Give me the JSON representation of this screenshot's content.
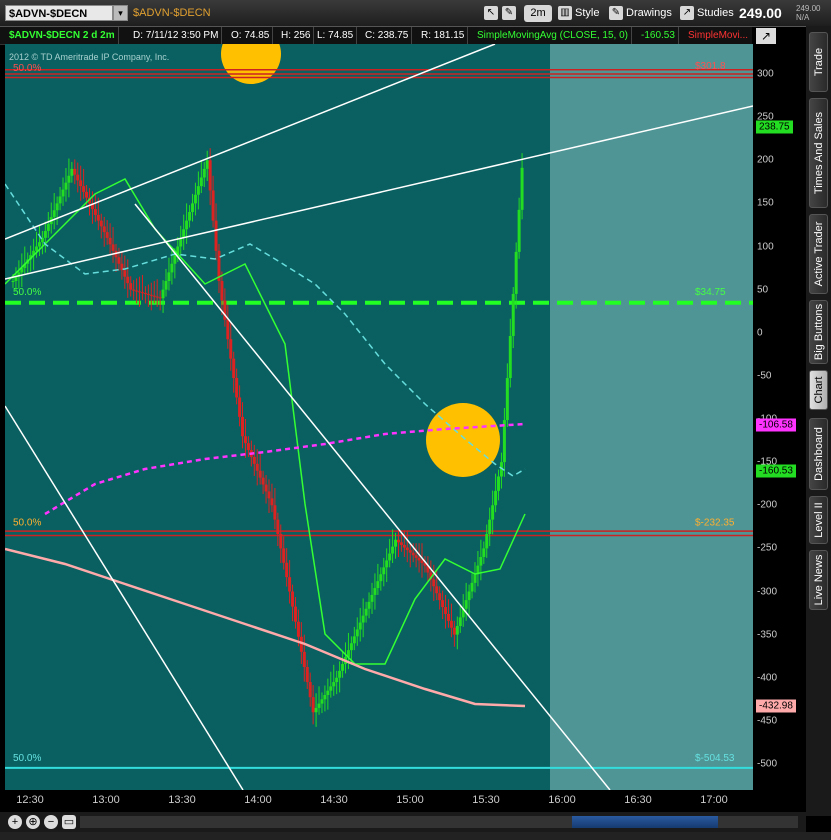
{
  "toolbar": {
    "symbol": "$ADVN-$DECN",
    "symbol_title": "$ADVN-$DECN",
    "timeframe": "2m",
    "style_label": "Style",
    "drawings_label": "Drawings",
    "studies_label": "Studies",
    "price": "249.00",
    "price_small_top": "249.00",
    "price_small_bottom": "N/A"
  },
  "info": {
    "title": "$ADVN-$DECN 2 d 2m",
    "date": "D: 7/11/12 3:50 PM",
    "open": "O: 74.85",
    "high": "H: 256",
    "low": "L: 74.85",
    "close": "C: 238.75",
    "range": "R: 181.15",
    "sma": "SimpleMovingAvg (CLOSE, 15, 0)",
    "sma_value": "-160.53",
    "sma_b": "SimpleMovi..."
  },
  "chart": {
    "copyright": "2012 © TD Ameritrade IP Company, Inc.",
    "fib_labels": [
      "50.0%",
      "50.0%",
      "50.0%",
      "50.0%"
    ],
    "level_labels": [
      "$301.8",
      "$34.75",
      "$-232.35",
      "$-504.53"
    ]
  },
  "axis": {
    "ticks": [
      "300",
      "250",
      "200",
      "150",
      "100",
      "50",
      "0",
      "-50",
      "-100",
      "-150",
      "-200",
      "-250",
      "-300",
      "-350",
      "-400",
      "-450",
      "-500"
    ],
    "badges": {
      "last": "238.75",
      "magenta": "-106.58",
      "green": "-160.53",
      "pink": "-432.98"
    }
  },
  "xaxis": [
    "12:30",
    "13:00",
    "13:30",
    "14:00",
    "14:30",
    "15:00",
    "15:30",
    "16:00",
    "16:30",
    "17:00"
  ],
  "tabs": [
    "Trade",
    "Times And Sales",
    "Active Trader",
    "Big Buttons",
    "Chart",
    "Dashboard",
    "Level II",
    "Live News"
  ],
  "colors": {
    "plot_bg": "#0a6060",
    "future_bg": "#4f9595",
    "up": "#22dd22",
    "down": "#dd2222",
    "sma": "#33ff33",
    "cyan_ma": "#66dddd",
    "magenta_ma": "#ff33ff",
    "pink_ma": "#ffaaaa",
    "level_green": "#22ff22",
    "level_red": "#cc2222",
    "level_cyan": "#33dddd",
    "highlight": "#ffc000"
  },
  "icons": [
    "dropdown-icon",
    "cursor-icon",
    "wrench-icon",
    "style-icon",
    "drawings-icon",
    "studies-icon",
    "drawing-tool-icon",
    "zoom-in-icon",
    "zoom-out-icon"
  ]
}
